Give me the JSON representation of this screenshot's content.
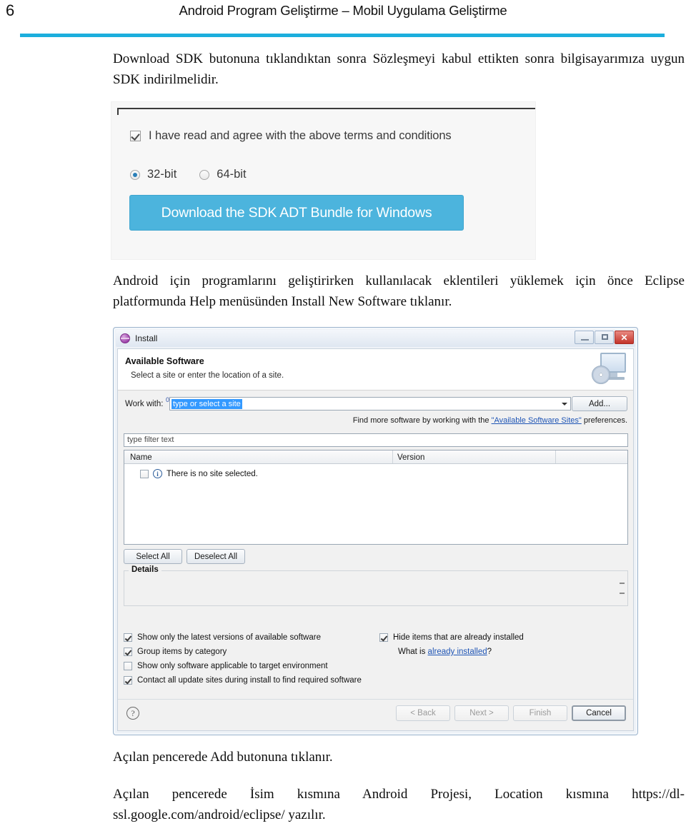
{
  "page": {
    "number": "6",
    "header_title": "Android Program Geliştirme – Mobil Uygulama Geliştirme",
    "rule_color": "#1CAEDD"
  },
  "paragraphs": {
    "intro": "Download SDK butonuna tıklandıktan sonra Sözleşmeyi kabul ettikten sonra bilgisayarımıza uygun SDK indirilmelidir.",
    "eclipse": "Android için programlarını geliştirirken kullanılacak eklentileri yüklemek için önce Eclipse platformunda Help menüsünden Install New Software tıklanır.",
    "add_button": "Açılan pencerede Add butonuna tıklanır.",
    "url_note": "Açılan pencerede İsim kısmına Android Projesi, Location kısmına https://dl-ssl.google.com/android/eclipse/ yazılır."
  },
  "sdk_figure": {
    "terms_checkbox_label": "I have read and agree with the above terms and conditions",
    "terms_checked": true,
    "arch_options": [
      {
        "label": "32-bit",
        "selected": true
      },
      {
        "label": "64-bit",
        "selected": false
      }
    ],
    "download_button_label": "Download the SDK ADT Bundle for Windows",
    "download_button_color": "#4cb4dd"
  },
  "install_dialog": {
    "window_title": "Install",
    "window_icon": "install-sphere-icon",
    "controls": {
      "minimize": "minimize-icon",
      "maximize": "maximize-icon",
      "close": "✕"
    },
    "banner": {
      "title": "Available Software",
      "subtitle": "Select a site or enter the location of a site.",
      "icon": "monitor-disc-icon"
    },
    "work_with": {
      "label": "Work with:",
      "superscript": "0",
      "value": "type or select a site",
      "value_selected": true,
      "add_button_label": "Add..."
    },
    "find_more": {
      "prefix": "Find more software by working with the ",
      "link": "\"Available Software Sites\"",
      "suffix": " preferences."
    },
    "filter_placeholder": "type filter text",
    "table": {
      "columns": [
        "Name",
        "Version"
      ],
      "rows": [
        {
          "checked": false,
          "icon": "info-icon",
          "name": "There is no site selected.",
          "version": ""
        }
      ]
    },
    "selection_buttons": {
      "select_all": "Select All",
      "deselect_all": "Deselect All"
    },
    "details": {
      "legend": "Details",
      "content": ""
    },
    "options_left": [
      {
        "label": "Show only the latest versions of available software",
        "checked": true
      },
      {
        "label": "Group items by category",
        "checked": true
      },
      {
        "label": "Show only software applicable to target environment",
        "checked": false
      },
      {
        "label": "Contact all update sites during install to find required software",
        "checked": true
      }
    ],
    "options_right": [
      {
        "label": "Hide items that are already installed",
        "checked": true
      }
    ],
    "what_is": {
      "prefix": "What is ",
      "link": "already installed",
      "suffix": "?"
    },
    "footer": {
      "help_icon": "?",
      "buttons": [
        {
          "label": "< Back",
          "enabled": false
        },
        {
          "label": "Next >",
          "enabled": false
        },
        {
          "label": "Finish",
          "enabled": false
        },
        {
          "label": "Cancel",
          "enabled": true,
          "default": true
        }
      ]
    }
  }
}
